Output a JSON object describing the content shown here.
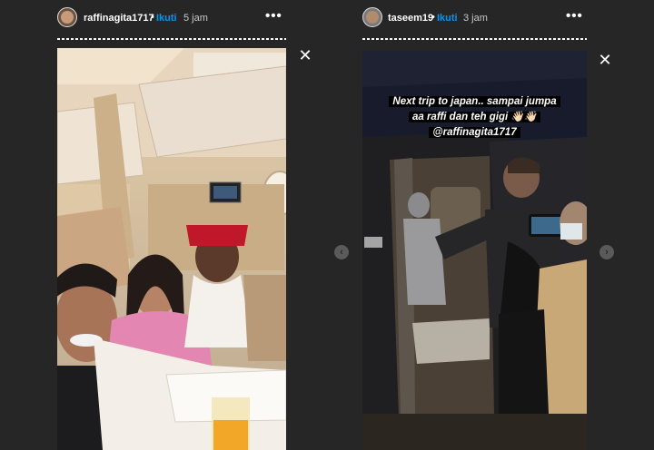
{
  "stories": [
    {
      "username": "raffinagita1717",
      "dot": "•",
      "follow_label": "Ikuti",
      "time": "5 jam",
      "more_glyph": "•••",
      "close_glyph": "✕",
      "avatar_icon": "profile-avatar",
      "photo": "airplane-cabin-selfie-with-flight-attendant"
    },
    {
      "username": "taseem19",
      "dot": "•",
      "follow_label": "Ikuti",
      "time": "3 jam",
      "more_glyph": "•••",
      "close_glyph": "✕",
      "avatar_icon": "profile-avatar",
      "photo": "people-boarding-van-at-night",
      "caption_lines": [
        "Next trip to japan.. sampai jumpa",
        "aa raffi dan teh gigi 👋🏻👋🏻",
        "@raffinagita1717"
      ]
    }
  ],
  "nav": {
    "prev_glyph": "‹",
    "next_glyph": "›"
  },
  "colors": {
    "background": "#262626",
    "follow": "#0095f6",
    "progress": "#ffffff"
  }
}
